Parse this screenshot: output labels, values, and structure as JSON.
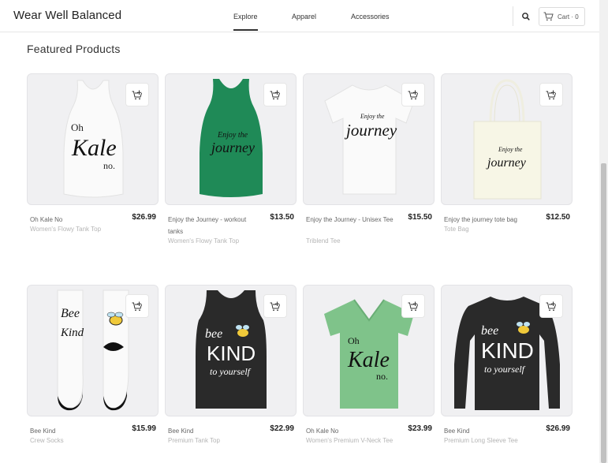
{
  "brand": "Wear Well Balanced",
  "nav": {
    "explore": "Explore",
    "apparel": "Apparel",
    "accessories": "Accessories"
  },
  "cart_label": "Cart · 0",
  "section_title": "Featured Products",
  "products": [
    {
      "name": "Oh Kale No",
      "price": "$26.99",
      "type": "Women's Flowy Tank Top",
      "print_line1": "Oh",
      "print_line2": "Kale",
      "print_line3": "no."
    },
    {
      "name": "Enjoy the Journey - workout tanks",
      "price": "$13.50",
      "type": "Women's Flowy Tank Top",
      "print_line1": "Enjoy the",
      "print_line2": "journey"
    },
    {
      "name": "Enjoy the Journey - Unisex Tee",
      "price": "$15.50",
      "type": "Triblend Tee",
      "print_line1": "Enjoy the",
      "print_line2": "journey"
    },
    {
      "name": "Enjoy the journey tote bag",
      "price": "$12.50",
      "type": "Tote Bag",
      "print_line1": "Enjoy the",
      "print_line2": "journey"
    },
    {
      "name": "Bee Kind",
      "price": "$15.99",
      "type": "Crew Socks",
      "print_line1": "Bee",
      "print_line2": "Kind"
    },
    {
      "name": "Bee Kind",
      "price": "$22.99",
      "type": "Premium Tank Top",
      "print_line1": "bee",
      "print_line2": "KIND",
      "print_line3": "to yourself"
    },
    {
      "name": "Oh Kale No",
      "price": "$23.99",
      "type": "Women's Premium V-Neck Tee",
      "print_line1": "Oh",
      "print_line2": "Kale",
      "print_line3": "no."
    },
    {
      "name": "Bee Kind",
      "price": "$26.99",
      "type": "Premium Long Sleeve Tee",
      "print_line1": "bee",
      "print_line2": "KIND",
      "print_line3": "to yourself"
    }
  ],
  "colors": {
    "accent": "#333333",
    "card_bg": "#f0f0f2",
    "green_tank": "#1f8a57",
    "mint_tee": "#7fc38a",
    "black": "#2a2a2a"
  },
  "icons": [
    "search-icon",
    "cart-icon",
    "add-to-cart-icon"
  ]
}
